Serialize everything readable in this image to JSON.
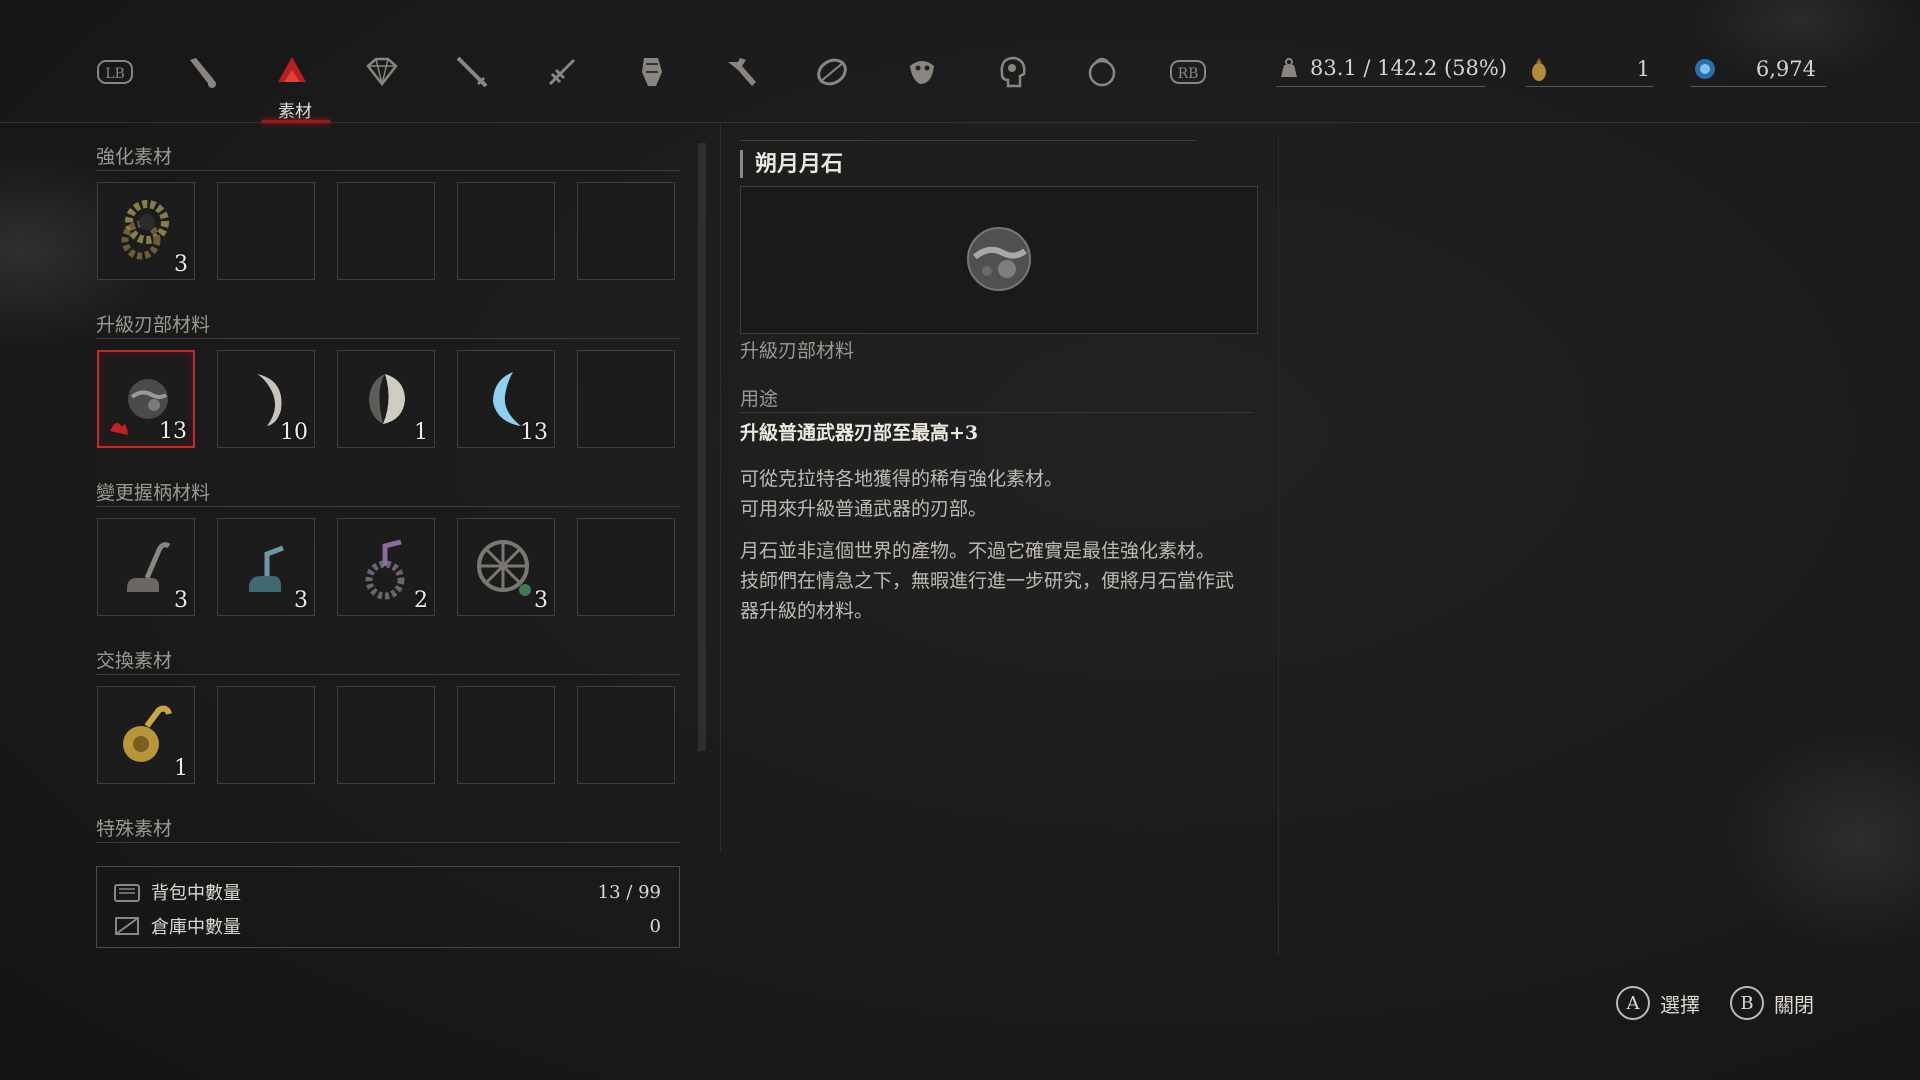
{
  "topbar": {
    "tabs": [
      {
        "name": "lb-bumper",
        "label": "LB"
      },
      {
        "name": "consumables-tab",
        "label": ""
      },
      {
        "name": "materials-tab",
        "label": "素材"
      },
      {
        "name": "amulets-tab",
        "label": ""
      },
      {
        "name": "weapons-tab",
        "label": ""
      },
      {
        "name": "legion-arm-tab",
        "label": ""
      },
      {
        "name": "body-tab",
        "label": ""
      },
      {
        "name": "tools-tab",
        "label": ""
      },
      {
        "name": "disc-tab",
        "label": ""
      },
      {
        "name": "mask-tab",
        "label": ""
      },
      {
        "name": "gestures-tab",
        "label": ""
      },
      {
        "name": "special-tab",
        "label": ""
      },
      {
        "name": "rb-bumper",
        "label": "RB"
      }
    ],
    "active_tab_label": "素材",
    "lb": "LB",
    "rb": "RB",
    "weight": "83.1 / 142.2 (58%)",
    "gold_coin": "1",
    "ergo": "6,974"
  },
  "categories": [
    {
      "title": "強化素材"
    },
    {
      "title": "升級刃部材料"
    },
    {
      "title": "變更握柄材料"
    },
    {
      "title": "交換素材"
    },
    {
      "title": "特殊素材"
    }
  ],
  "slots": {
    "enhance": [
      "3",
      "",
      "",
      "",
      ""
    ],
    "blade": [
      "13",
      "10",
      "1",
      "13",
      ""
    ],
    "handle": [
      "3",
      "3",
      "2",
      "3",
      ""
    ],
    "exchange": [
      "1",
      "",
      "",
      "",
      ""
    ]
  },
  "counts": {
    "bag_label": "背包中數量",
    "bag_value": "13 / 99",
    "storage_label": "倉庫中數量",
    "storage_value": "0"
  },
  "detail": {
    "name": "朔月月石",
    "category": "升級刃部材料",
    "usage_header": "用途",
    "usage": "升級普通武器刃部至最高+3",
    "desc1": "可從克拉特各地獲得的稀有強化素材。",
    "desc2": "可用來升級普通武器的刃部。",
    "lore1": "月石並非這個世界的產物。不過它確實是最佳強化素材。",
    "lore2": "技師們在情急之下，無暇進行進一步研究，便將月石當作武",
    "lore3": "器升級的材料。"
  },
  "footer": {
    "a_key": "A",
    "a_label": "選擇",
    "b_key": "B",
    "b_label": "關閉"
  },
  "colors": {
    "accent": "#c52a2a",
    "text": "#cfcac2",
    "bg": "#1b1b1c"
  }
}
